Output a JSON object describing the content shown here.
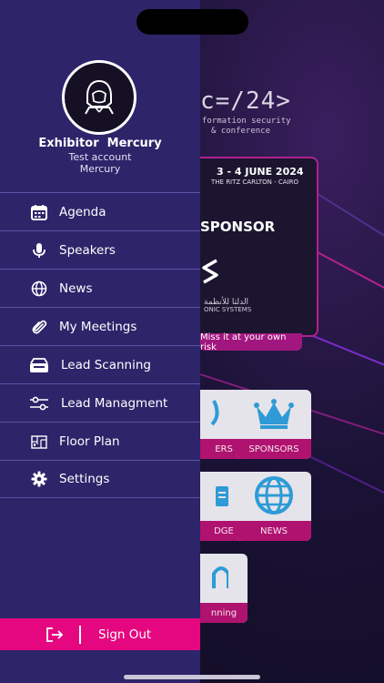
{
  "background": {
    "logo_text": "c=/24>",
    "tagline": [
      "formation security",
      "& conference"
    ],
    "banner": {
      "date": "3 - 4 JUNE 2024",
      "venue": "THE RITZ CARLTON - CAIRO",
      "sponsor_label": "SPONSOR",
      "arabic_text": "الدلتا للأنظمة",
      "company_fragment": "ONIC SYSTEMS"
    },
    "miss_it": "Miss it at your own risk",
    "tiles": [
      {
        "label": "ERS",
        "icon": "microphone-icon"
      },
      {
        "label": "SPONSORS",
        "icon": "crown-icon"
      },
      {
        "label": "DGE",
        "icon": "badge-icon"
      },
      {
        "label": "NEWS",
        "icon": "globe-icon"
      },
      {
        "label": "nning",
        "icon": "scanner-icon"
      }
    ],
    "colors": {
      "accent": "#b0126f",
      "tile_bg": "#e5e4ea",
      "crown": "#2e9bd6"
    }
  },
  "drawer": {
    "profile": {
      "name": "Exhibitor  Mercury",
      "account": "Test account",
      "company": "Mercury",
      "avatar_icon": "hooded-person-icon"
    },
    "menu": [
      {
        "label": "Agenda",
        "icon": "calendar-icon"
      },
      {
        "label": "Speakers",
        "icon": "microphone-icon"
      },
      {
        "label": "News",
        "icon": "globe-icon"
      },
      {
        "label": "My Meetings",
        "icon": "paperclip-icon"
      },
      {
        "label": "Lead Scanning",
        "icon": "scanner-icon"
      },
      {
        "label": "Lead Managment",
        "icon": "sliders-icon"
      },
      {
        "label": "Floor Plan",
        "icon": "floor-plan-icon"
      },
      {
        "label": "Settings",
        "icon": "gear-icon"
      }
    ],
    "sign_out": {
      "label": "Sign Out",
      "icon": "logout-icon"
    },
    "colors": {
      "drawer_bg": "#2d246a",
      "sign_out_bg": "#e5077f",
      "divider": "#5a52a3"
    }
  }
}
